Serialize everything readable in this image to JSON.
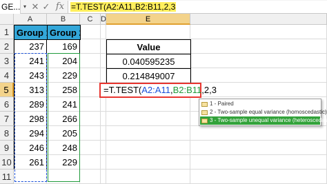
{
  "formula_bar": {
    "name_box": "GE...",
    "cancel_glyph": "✕",
    "enter_glyph": "✓",
    "fx_label": "fx",
    "formula": "=T.TEST(A2:A11,B2:B11,2,3"
  },
  "columns": [
    "A",
    "B",
    "C",
    "D",
    "E"
  ],
  "active_column": "E",
  "rows": [
    "1",
    "2",
    "3",
    "4",
    "5",
    "6",
    "7",
    "8",
    "9",
    "10",
    "11"
  ],
  "active_row": "5",
  "table": {
    "headers": [
      "Group 1",
      "Group 2"
    ],
    "group1": [
      "237",
      "241",
      "243",
      "313",
      "289",
      "298",
      "294",
      "246",
      "261"
    ],
    "group2": [
      "169",
      "204",
      "229",
      "258",
      "241",
      "266",
      "205",
      "248",
      "229"
    ],
    "header_color": "#33a7d9"
  },
  "value_table": {
    "header": "Value",
    "values": [
      "0.040595235",
      "0.214849007"
    ]
  },
  "editing": {
    "prefix": "=T.TEST(",
    "ref_a": "A2:A11",
    "sep1": ",",
    "ref_b": "B2:B11",
    "rest": ",2,3",
    "ref_a_color": "#1a4fd8",
    "ref_b_color": "#1f9a3a",
    "border_color": "#e8352f"
  },
  "autocomplete": {
    "items": [
      {
        "label": "1 - Paired",
        "selected": false
      },
      {
        "label": "2 - Two-sample equal variance (homoscedastic)",
        "selected": false
      },
      {
        "label": "3 - Two-sample unequal variance (heteroscedastic)",
        "selected": true
      }
    ],
    "selected_color": "#32a23a"
  }
}
